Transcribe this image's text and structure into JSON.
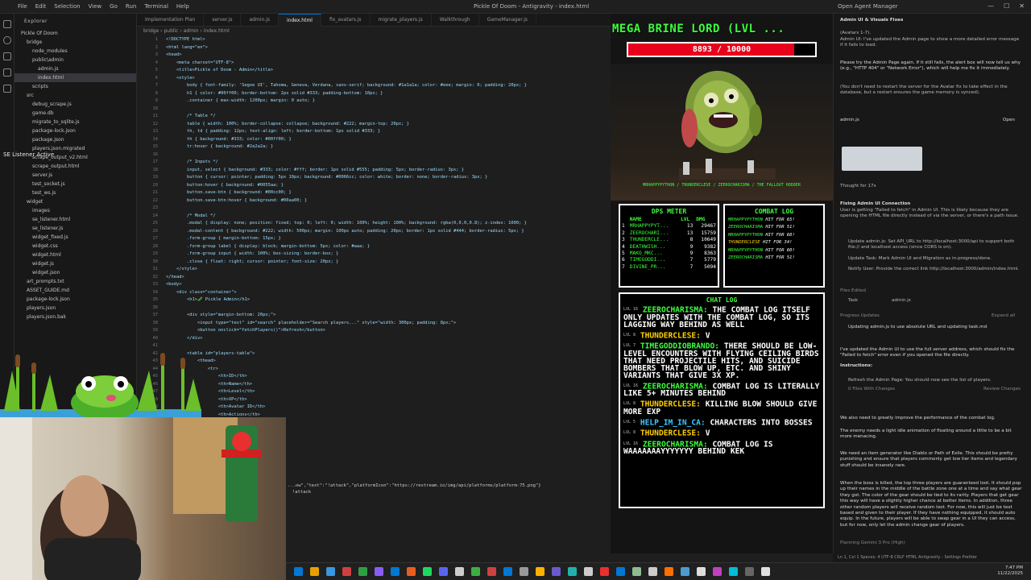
{
  "window": {
    "title": "Pickle Of Doom - Antigravity - index.html",
    "menu": [
      "File",
      "Edit",
      "Selection",
      "View",
      "Go",
      "Run",
      "Terminal",
      "Help"
    ],
    "agent_manager": "Open Agent Manager"
  },
  "explorer": {
    "header": "Explorer",
    "items": [
      "Pickle Of Doom",
      "bridge",
      "node_modules",
      "public\\admin",
      "admin.js",
      "index.html",
      "scripts",
      "src",
      "debug_scrape.js",
      "game.db",
      "migrate_to_sqlite.js",
      "package-lock.json",
      "package.json",
      "players.json.migrated",
      "scrape_output_v2.html",
      "scrape_output.html",
      "server.js",
      "test_socket.js",
      "test_ws.js",
      "widget",
      "images",
      "se_listener.html",
      "se_listener.js",
      "widget_fixed.js",
      "widget.css",
      "widget.html",
      "widget.js",
      "widget.json",
      "art_prompts.txt",
      "ASSET_GUIDE.md",
      "package-lock.json",
      "players.json",
      "players.json.bak"
    ]
  },
  "tabs": [
    "Implementation Plan",
    "server.js",
    "admin.js",
    "index.html",
    "fix_avatars.js",
    "migrate_players.js",
    "Walkthrough",
    "GameManager.js"
  ],
  "breadcrumb": "bridge › public › admin › index.html",
  "editor": {
    "lines": [
      "<!DOCTYPE html>",
      "<html lang=\"en\">",
      "<head>",
      "    <meta charset=\"UTF-8\">",
      "    <title>Pickle of Doom - Admin</title>",
      "    <style>",
      "        body { font-family: 'Segoe UI', Tahoma, Geneva, Verdana, sans-serif; background: #1a1a1a; color: #eee; margin: 0; padding: 20px; }",
      "        h1 { color: #00ff00; border-bottom: 2px solid #333; padding-bottom: 10px; }",
      "        .container { max-width: 1200px; margin: 0 auto; }",
      "",
      "        /* Table */",
      "        table { width: 100%; border-collapse: collapse; background: #222; margin-top: 20px; }",
      "        th, td { padding: 12px; text-align: left; border-bottom: 1px solid #333; }",
      "        th { background: #333; color: #00ff00; }",
      "        tr:hover { background: #2a2a2a; }",
      "",
      "        /* Inputs */",
      "        input, select { background: #333; color: #fff; border: 1px solid #555; padding: 5px; border-radius: 3px; }",
      "        button { cursor: pointer; padding: 5px 10px; background: #0066cc; color: white; border: none; border-radius: 3px; }",
      "        button:hover { background: #0055aa; }",
      "        button.save-btn { background: #00cc00; }",
      "        button.save-btn:hover { background: #00aa00; }",
      "",
      "        /* Modal */",
      "        .modal { display: none; position: fixed; top: 0; left: 0; width: 100%; height: 100%; background: rgba(0,0,0,0.8); z-index: 1000; }",
      "        .modal-content { background: #222; width: 500px; margin: 100px auto; padding: 20px; border: 1px solid #444; border-radius: 5px; }",
      "        .form-group { margin-bottom: 15px; }",
      "        .form-group label { display: block; margin-bottom: 5px; color: #aaa; }",
      "        .form-group input { width: 100%; box-sizing: border-box; }",
      "        .close { float: right; cursor: pointer; font-size: 20px; }",
      "    </style>",
      "</head>",
      "<body>",
      "    <div class=\"container\">",
      "        <h1>🥒 Pickle Admin</h1>",
      "",
      "        <div style=\"margin-bottom: 20px;\">",
      "            <input type=\"text\" id=\"search\" placeholder=\"Search players...\" style=\"width: 300px; padding: 8px;\">",
      "            <button onclick=\"fetchPlayers()\">Refresh</button>",
      "        </div>",
      "",
      "        <table id=\"players-table\">",
      "            <thead>",
      "                <tr>",
      "                    <th>ID</th>",
      "                    <th>Name</th>",
      "                    <th>Level</th>",
      "                    <th>XP</th>",
      "                    <th>Avatar ID</th>",
      "                    <th>Actions</th>"
    ]
  },
  "terminal": {
    "line1": "...ow\",\"text\":\"!attack\",\"platformIcon\":\"https://restream.io/img/api/platforms/platform-75.png\"}",
    "line2": "!attack"
  },
  "overlay": {
    "listener_label": "SE Listener Active"
  },
  "game": {
    "boss_name": "MEGA BRINE LORD (LVL ...",
    "hp_current": 8893,
    "hp_max": 10000,
    "hp_text": "8893 / 10000",
    "ground_label": "MRHAPPYPYTHON / THUNDERCLESE / ZEEROCHARISMA / THE FALLOUT HODDER",
    "dps": {
      "title": "DPS METER",
      "headers": [
        "NAME",
        "LVL",
        "DMG"
      ],
      "rows": [
        {
          "rank": "1",
          "name": "MRHAPPYPYT...",
          "lvl": "13",
          "dmg": "29467"
        },
        {
          "rank": "2",
          "name": "ZEEROCHARI...",
          "lvl": "13",
          "dmg": "15759"
        },
        {
          "rank": "3",
          "name": "THUNDERCLE...",
          "lvl": "8",
          "dmg": "10649"
        },
        {
          "rank": "4",
          "name": "DEATHWISH...",
          "lvl": "9",
          "dmg": "9382"
        },
        {
          "rank": "5",
          "name": "MAKO_MKC...",
          "lvl": "9",
          "dmg": "8363"
        },
        {
          "rank": "6",
          "name": "TIMEGODDI...",
          "lvl": "7",
          "dmg": "5779"
        },
        {
          "rank": "7",
          "name": "DIVINE_PR...",
          "lvl": "7",
          "dmg": "5094"
        }
      ]
    },
    "combat": {
      "title": "COMBAT LOG",
      "entries": [
        {
          "who": "MRHAPPYPYTHON",
          "text": "HIT FOR 65!"
        },
        {
          "who": "ZEEROCHARISMA",
          "text": "HIT FOR 51!"
        },
        {
          "who": "MRHAPPYPYTHON",
          "text": "HIT FOR 68!"
        },
        {
          "who": "THUNDERCLESE",
          "text": "HIT FOR 34!"
        },
        {
          "who": "MRHAPPYPYTHON",
          "text": "HIT FOR 60!"
        },
        {
          "who": "ZEEROCHARISMA",
          "text": "HIT FOR 51!"
        }
      ]
    },
    "chat": {
      "title": "CHAT LOG",
      "messages": [
        {
          "lvl": "LVL 16",
          "who": "ZEEROCHARISMA:",
          "text": "THE COMBAT LOG ITSELF ONLY UPDATES WITH THE COMBAT LOG, SO ITS LAGGING WAY BEHIND AS WELL"
        },
        {
          "lvl": "LVL 8",
          "who": "THUNDERCLESE:",
          "text": "V"
        },
        {
          "lvl": "LVL 7",
          "who": "TIMEGODDIOBRANDO:",
          "text": "THERE SHOULD BE LOW-LEVEL ENCOUNTERS WITH FLYING CEILING BIRDS THAT NEED PROJECTILE HITS, AND SUICIDE BOMBERS THAT BLOW UP, ETC. AND SHINY VARIANTS THAT GIVE 3X XP."
        },
        {
          "lvl": "LVL 16",
          "who": "ZEEROCHARISMA:",
          "text": "COMBAT LOG IS LITERALLY LIKE 5+ MINUTES BEHIND"
        },
        {
          "lvl": "LVL 8",
          "who": "THUNDERCLESE:",
          "text": "KILLING BLOW SHOULD GIVE MORE EXP"
        },
        {
          "lvl": "LVL 5",
          "who": "HELP_IM_IN_CA:",
          "text": "CHARACTERS INTO BOSSES"
        },
        {
          "lvl": "LVL 8",
          "who": "THUNDERCLESE:",
          "text": "V"
        },
        {
          "lvl": "LVL 16",
          "who": "ZEEROCHARISMA:",
          "text": "COMBAT LOG IS WAAAAAAAYYYYYYY BEHIND KEK"
        }
      ]
    }
  },
  "agent": {
    "header": "Admin UI & Visuals Fixes",
    "p1": "(Avatars 1-7).",
    "p2": "Admin UI: I've updated the Admin page to show a more detailed error message if it fails to load.",
    "p3": "Please try the Admin Page again. If it still fails, the alert box will now tell us why (e.g., \"HTTP 404\" or \"Network Error\"), which will help me fix it immediately.",
    "p4": "(You don't need to restart the server for the Avatar fix to take effect in the database, but a restart ensures the game memory is synced).",
    "file1": "admin.js",
    "open": "Open",
    "thought": "Thought for 17s",
    "fixing_title": "Fixing Admin UI Connection",
    "fixing_body": "User is getting \"Failed to fetch\" in Admin UI. This is likely because they are opening the HTML file directly instead of via the server, or there's a path issue.",
    "b1": "Update admin.js: Set API_URL to http://localhost:3000/api to support both file:// and localhost access (since CORS is on).",
    "b2": "Update Task: Mark Admin UI and Migration as in-progress/done.",
    "b3": "Notify User: Provide the correct link http://localhost:3000/admin/index.html.",
    "files_edited": "Files Edited",
    "task": "Task",
    "file2": "admin.js",
    "progress": "Progress Updates",
    "expand": "Expand all",
    "update1": "Updating admin.js to use absolute URL and updating task.md",
    "p5": "I've updated the Admin UI to use the full server address, which should fix the \"Failed to fetch\" error even if you opened the file directly.",
    "instructions": "Instructions:",
    "step1": "Refresh the Admin Page: You should now see the list of players.",
    "files_changes": "0 Files With Changes",
    "review": "Review Changes",
    "u1": "We also need to greatly improve the performance of the combat log.",
    "u2": "The enemy needs a light idle animation of floating around a little to be a bit more menacing.",
    "u3": "We need an item generator like Diablo or Path of Exile. This should be pretty punishing and ensure that players commonly get low tier items and legendary stuff should be insanely rare.",
    "u4": "When the boss is killed, the top three players are guaranteed loot. It should pop up their names in the middle of the battle zone one at a time and say what gear they got. The color of the gear should be tied to its rarity. Players that get gear this way will have a slightly higher chance at better items. In addition, three other random players will receive random loot. For now, this will just be text based and given to their player. If they have nothing equipped, it should auto equip. In the future, players will be able to swap gear in a UI they can access, but for now, only let the admin change gear of players.",
    "footer": "Planning   Gemini 3 Pro (High)"
  },
  "statusbar": "Ln 1, Col 1   Spaces: 4   UTF-8   CRLF   HTML   Antigravity - Settings   Prettier",
  "clock": {
    "time": "7:47 PM",
    "date": "11/22/2025"
  },
  "colors": {
    "accent": "#0078d4",
    "game_green": "#3cff3c",
    "hp_red": "#e8001c"
  }
}
